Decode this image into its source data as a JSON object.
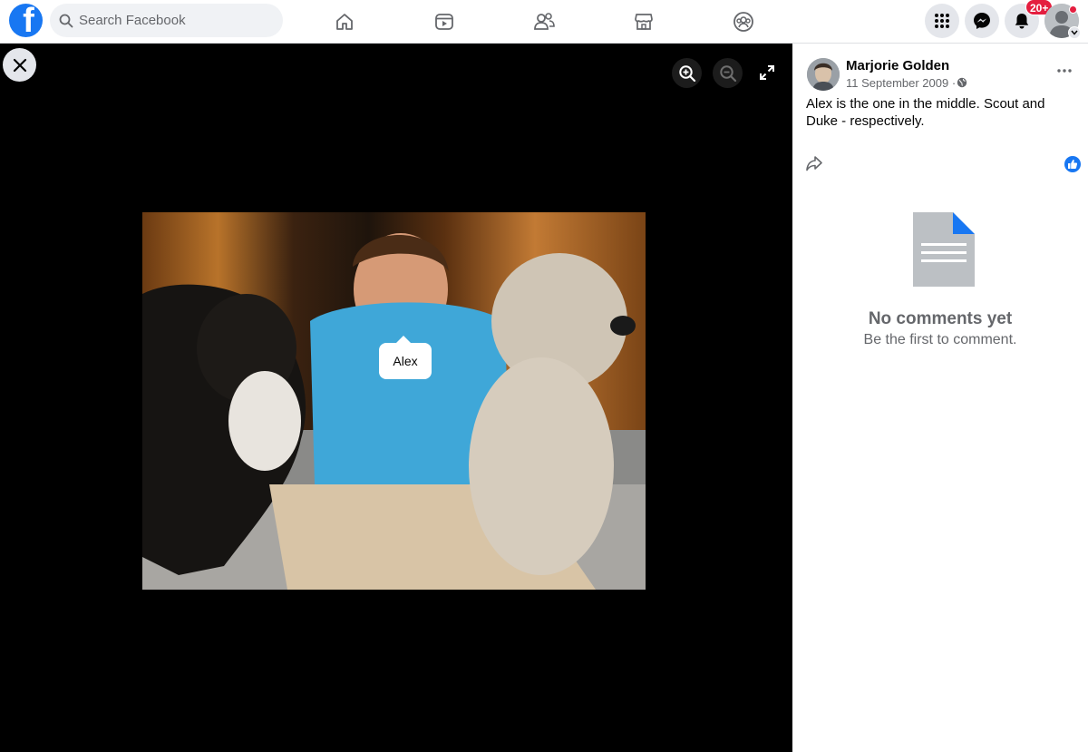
{
  "header": {
    "logo_letter": "f",
    "search_placeholder": "Search Facebook",
    "nav_icons": [
      "home-icon",
      "watch-icon",
      "friends-icon",
      "marketplace-icon",
      "groups-icon"
    ],
    "notification_badge": "20+",
    "accent_color": "#1877f2"
  },
  "viewer": {
    "tag_label": "Alex",
    "photo_alt": ""
  },
  "post": {
    "author": "Marjorie Golden",
    "date": "11 September 2009 ·",
    "caption": "Alex is the one in the middle. Scout and Duke - respectively."
  },
  "comments": {
    "empty_title": "No comments yet",
    "empty_subtitle": "Be the first to comment."
  }
}
